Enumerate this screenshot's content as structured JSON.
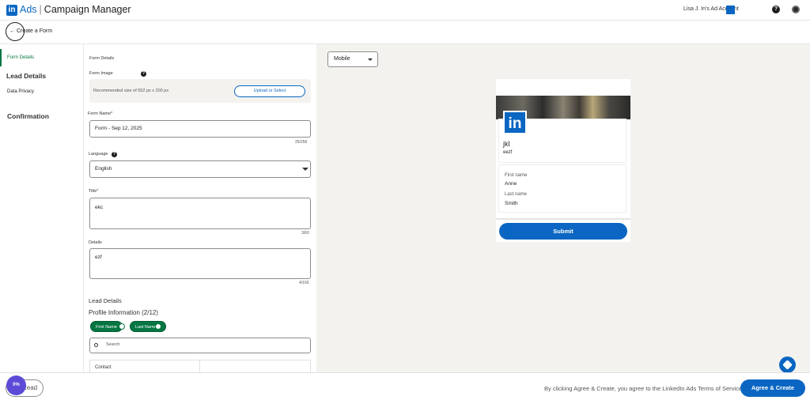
{
  "header": {
    "logo": "in",
    "brand_ads": "Ads",
    "brand_separator": "|",
    "brand_campaign": "Campaign Manager",
    "account_name": "Lisa J. In's Ad Account",
    "help_icon": "question-icon",
    "avatar_icon": "avatar-icon"
  },
  "subheader": {
    "back_label": "← Create a Form"
  },
  "sidebar": {
    "items": [
      {
        "label": "Form Details",
        "active": true
      },
      {
        "label": "Lead Details"
      },
      {
        "label": "Data Privacy"
      },
      {
        "label": "Confirmation"
      }
    ]
  },
  "form": {
    "section_label": "Form Details",
    "form_image_label": "Form Image",
    "image_hint": "Recommended size of 552 px x 200 px",
    "upload_label": "Upload or Select",
    "form_name_label": "Form Name*",
    "form_name_value": "Form - Sep 12, 2025",
    "form_name_counter": "25/256",
    "language_label": "Language",
    "language_value": "English",
    "title_label": "Title*",
    "title_value": "ekc",
    "title_counter": "3/60",
    "details_label": "Details",
    "details_value": "ezf",
    "details_counter": "4/160",
    "lead_details_heading": "Lead Details",
    "profile_info_heading": "Profile Information (2/12)",
    "chips": [
      "First Name",
      "Last Name X"
    ],
    "search_placeholder": "Search",
    "table_first_row": "Contact"
  },
  "preview": {
    "device_select": "Mobile",
    "logo": "in",
    "title": "jkl",
    "subtitle": "eezf",
    "fields": [
      {
        "label": "First name",
        "value": "Anne"
      },
      {
        "label": "Last name",
        "value": "Smith"
      }
    ],
    "submit_label": "Submit"
  },
  "footer": {
    "terms": "By clicking Agree & Create, you agree to the LinkedIn Ads Terms of Service.",
    "agree_label": "Agree & Create",
    "read_label": "Read",
    "read_badge": "0%"
  },
  "colors": {
    "accent": "#0a66c2",
    "green": "#057642",
    "preview_bg": "#f3f2ef"
  }
}
